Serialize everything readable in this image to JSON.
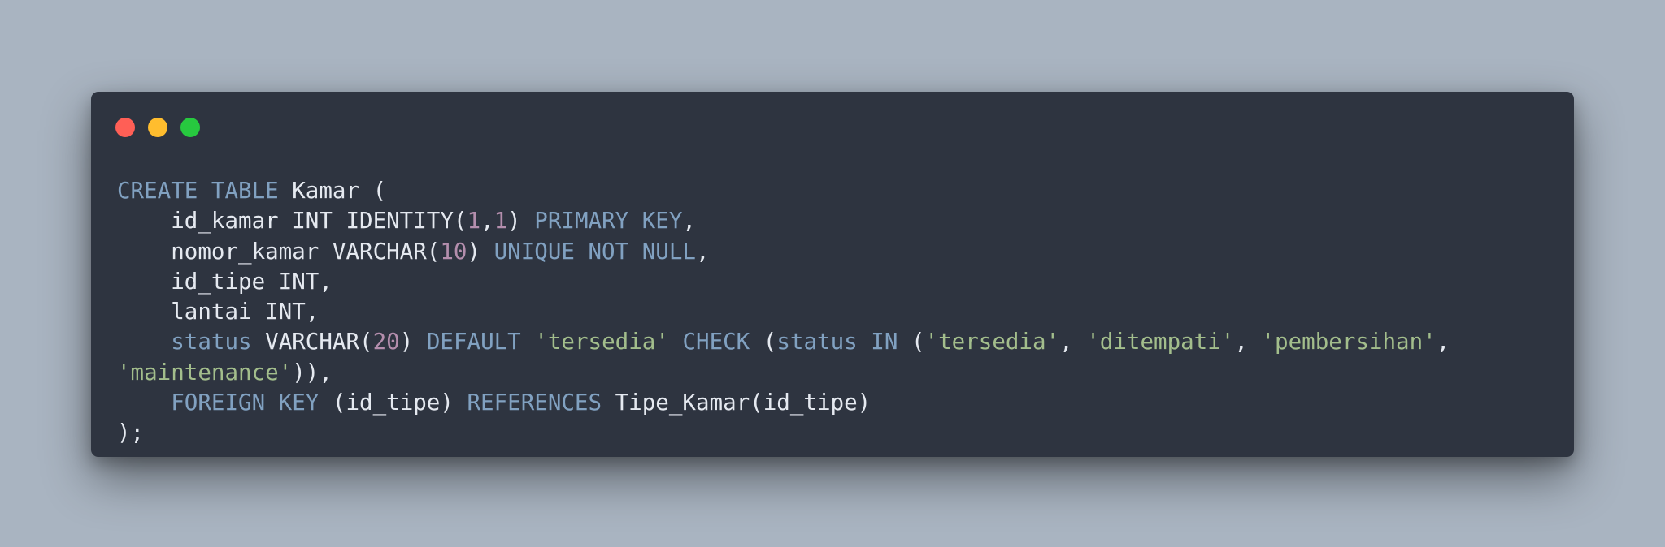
{
  "window": {
    "controls": [
      {
        "name": "close",
        "color": "#ff5f56"
      },
      {
        "name": "minimize",
        "color": "#ffbd2e"
      },
      {
        "name": "maximize",
        "color": "#27c93f"
      }
    ]
  },
  "code": {
    "lines": [
      [
        {
          "t": "CREATE TABLE",
          "c": "kw"
        },
        {
          "t": " Kamar (",
          "c": "plain"
        }
      ],
      [
        {
          "t": "    id_kamar INT IDENTITY(",
          "c": "plain"
        },
        {
          "t": "1",
          "c": "num"
        },
        {
          "t": ",",
          "c": "plain"
        },
        {
          "t": "1",
          "c": "num"
        },
        {
          "t": ") ",
          "c": "plain"
        },
        {
          "t": "PRIMARY KEY",
          "c": "kw"
        },
        {
          "t": ",",
          "c": "plain"
        }
      ],
      [
        {
          "t": "    nomor_kamar VARCHAR(",
          "c": "plain"
        },
        {
          "t": "10",
          "c": "num"
        },
        {
          "t": ") ",
          "c": "plain"
        },
        {
          "t": "UNIQUE NOT NULL",
          "c": "kw"
        },
        {
          "t": ",",
          "c": "plain"
        }
      ],
      [
        {
          "t": "    id_tipe INT,",
          "c": "plain"
        }
      ],
      [
        {
          "t": "    lantai INT,",
          "c": "plain"
        }
      ],
      [
        {
          "t": "    ",
          "c": "plain"
        },
        {
          "t": "status",
          "c": "kw"
        },
        {
          "t": " VARCHAR(",
          "c": "plain"
        },
        {
          "t": "20",
          "c": "num"
        },
        {
          "t": ") ",
          "c": "plain"
        },
        {
          "t": "DEFAULT",
          "c": "kw"
        },
        {
          "t": " ",
          "c": "plain"
        },
        {
          "t": "'tersedia'",
          "c": "str"
        },
        {
          "t": " ",
          "c": "plain"
        },
        {
          "t": "CHECK",
          "c": "kw"
        },
        {
          "t": " (",
          "c": "plain"
        },
        {
          "t": "status",
          "c": "kw"
        },
        {
          "t": " ",
          "c": "plain"
        },
        {
          "t": "IN",
          "c": "kw"
        },
        {
          "t": " (",
          "c": "plain"
        },
        {
          "t": "'tersedia'",
          "c": "str"
        },
        {
          "t": ", ",
          "c": "plain"
        },
        {
          "t": "'ditempati'",
          "c": "str"
        },
        {
          "t": ", ",
          "c": "plain"
        },
        {
          "t": "'pembersihan'",
          "c": "str"
        },
        {
          "t": ",",
          "c": "plain"
        }
      ],
      [
        {
          "t": "'maintenance'",
          "c": "str"
        },
        {
          "t": ")),",
          "c": "plain"
        }
      ],
      [
        {
          "t": "    ",
          "c": "plain"
        },
        {
          "t": "FOREIGN KEY",
          "c": "kw"
        },
        {
          "t": " (id_tipe) ",
          "c": "plain"
        },
        {
          "t": "REFERENCES",
          "c": "kw"
        },
        {
          "t": " Tipe_Kamar(id_tipe)",
          "c": "plain"
        }
      ],
      [
        {
          "t": ");",
          "c": "plain"
        }
      ]
    ]
  }
}
